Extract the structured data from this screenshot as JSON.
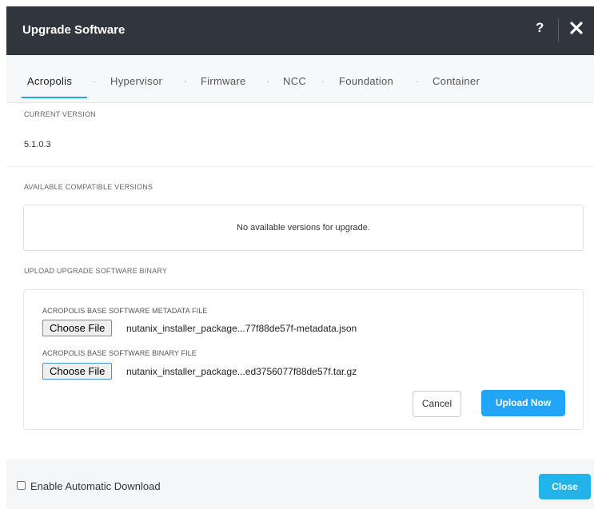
{
  "dialog": {
    "title": "Upgrade Software",
    "help_icon": "?",
    "close_icon_name": "close-icon"
  },
  "tabs": [
    {
      "label": "Acropolis",
      "active": true
    },
    {
      "label": "Hypervisor",
      "active": false
    },
    {
      "label": "Firmware",
      "active": false
    },
    {
      "label": "NCC",
      "active": false
    },
    {
      "label": "Foundation",
      "active": false
    },
    {
      "label": "Container",
      "active": false
    }
  ],
  "tab_separator": "·",
  "current": {
    "label": "CURRENT VERSION",
    "value": "5.1.0.3"
  },
  "available": {
    "label": "AVAILABLE COMPATIBLE VERSIONS",
    "message": "No available versions for upgrade."
  },
  "upload": {
    "label": "UPLOAD UPGRADE SOFTWARE BINARY",
    "metadata": {
      "label": "ACROPOLIS BASE SOFTWARE METADATA FILE",
      "button": "Choose File",
      "file": "nutanix_installer_package...77f88de57f-metadata.json"
    },
    "binary": {
      "label": "ACROPOLIS BASE SOFTWARE BINARY FILE",
      "button": "Choose File",
      "file": "nutanix_installer_package...ed3756077f88de57f.tar.gz"
    },
    "cancel_label": "Cancel",
    "upload_label": "Upload Now"
  },
  "footer": {
    "checkbox_label": "Enable Automatic Download",
    "checkbox_checked": false,
    "close_label": "Close"
  },
  "colors": {
    "header_bg": "#31353c",
    "accent": "#22a5f7",
    "close_button": "#22b4e8"
  }
}
